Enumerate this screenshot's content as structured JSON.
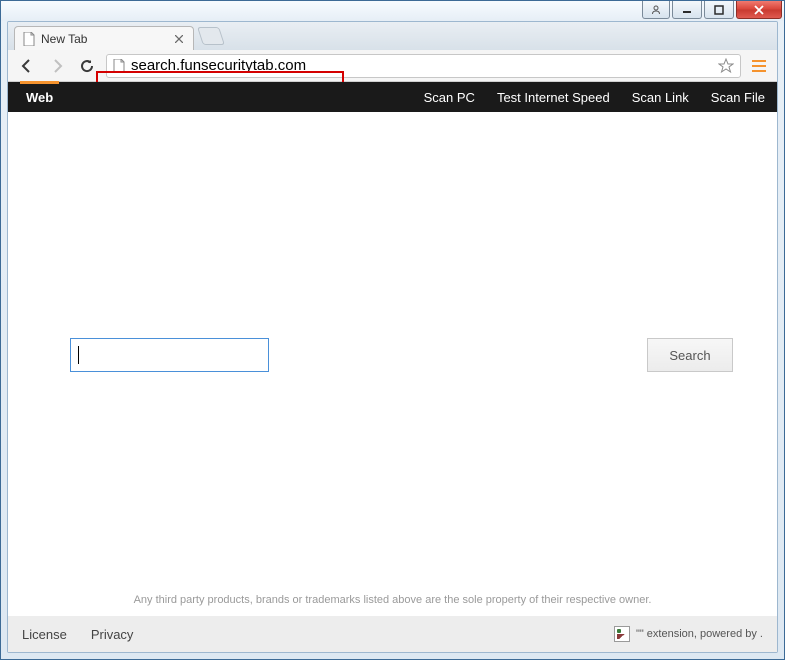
{
  "window": {
    "tab_title": "New Tab"
  },
  "omnibox": {
    "url": "search.funsecuritytab.com"
  },
  "blackbar": {
    "active": "Web",
    "links": [
      "Scan PC",
      "Test Internet Speed",
      "Scan Link",
      "Scan File"
    ]
  },
  "search": {
    "input_value": "",
    "button_label": "Search"
  },
  "disclaimer": "Any third party products, brands or trademarks listed above are the sole property of their respective owner.",
  "footer": {
    "links": [
      "License",
      "Privacy"
    ],
    "right_text": "\"\" extension, powered by ."
  }
}
